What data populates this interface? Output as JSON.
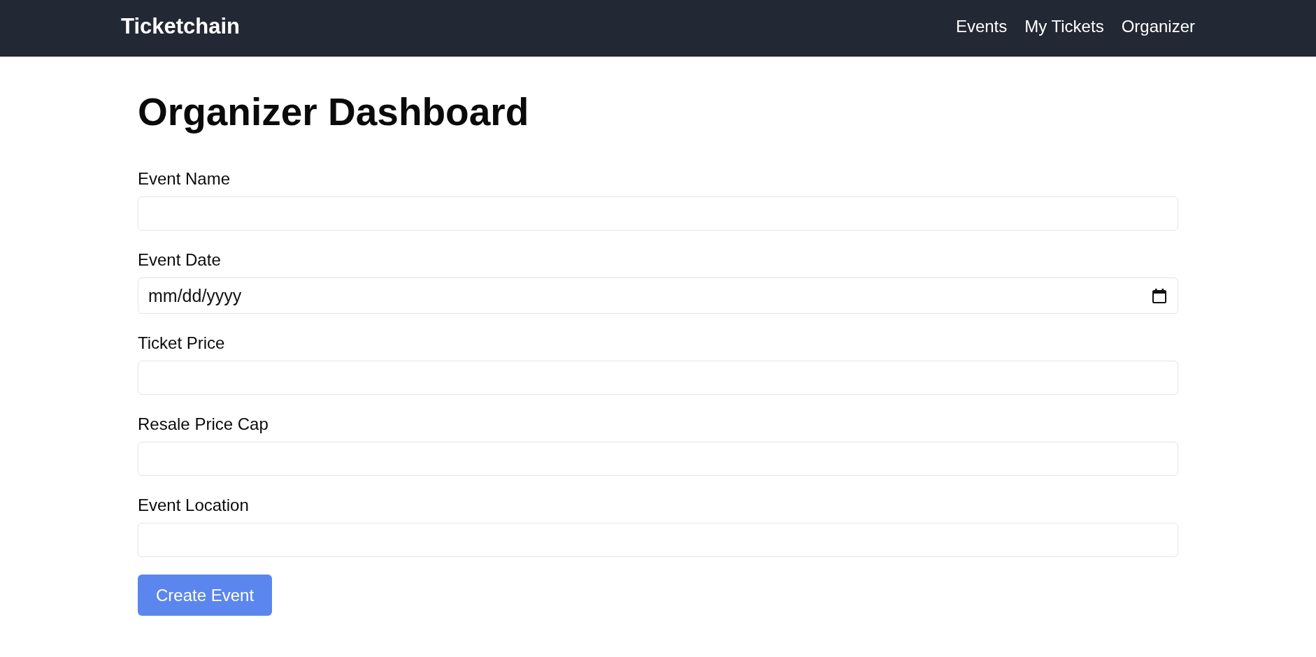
{
  "navbar": {
    "logo": "Ticketchain",
    "links": [
      "Events",
      "My Tickets",
      "Organizer"
    ]
  },
  "page": {
    "title": "Organizer Dashboard"
  },
  "form": {
    "fields": [
      {
        "label": "Event Name",
        "kind": "text"
      },
      {
        "label": "Event Date",
        "kind": "date",
        "placeholder": "mm/dd/yyyy"
      },
      {
        "label": "Ticket Price",
        "kind": "text"
      },
      {
        "label": "Resale Price Cap",
        "kind": "text"
      },
      {
        "label": "Event Location",
        "kind": "text"
      }
    ],
    "submit": "Create Event"
  }
}
